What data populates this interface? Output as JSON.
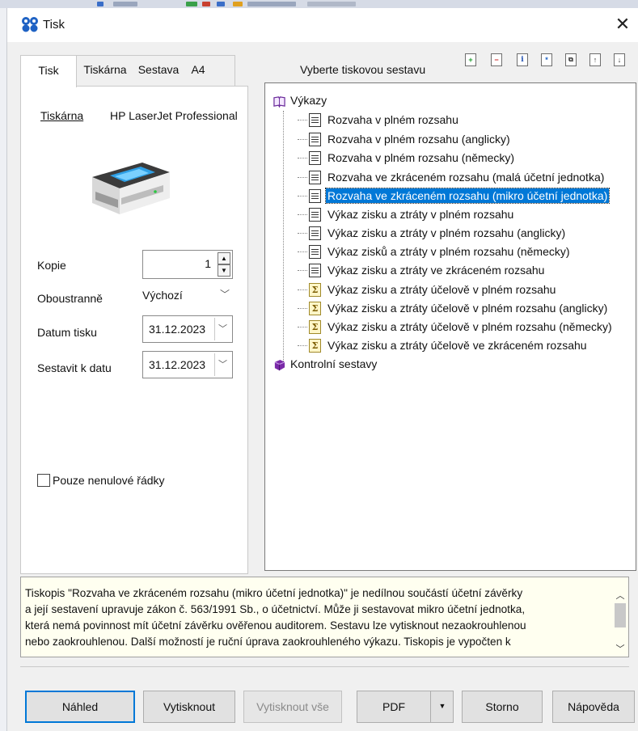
{
  "window": {
    "title": "Tisk",
    "close_glyph": "✕"
  },
  "tabs": [
    {
      "label": "Tisk",
      "active": true
    },
    {
      "label": "Tiskárna"
    },
    {
      "label": "Sestava"
    },
    {
      "label": "A4"
    }
  ],
  "printer": {
    "label": "Tiskárna",
    "name": "HP LaserJet Professional"
  },
  "fields": {
    "copies": {
      "label": "Kopie",
      "value": "1"
    },
    "duplex": {
      "label": "Oboustranně",
      "value": "Výchozí"
    },
    "print_date": {
      "label": "Datum tisku",
      "value": "31.12.2023"
    },
    "build_date": {
      "label": "Sestavit k datu",
      "value": "31.12.2023"
    }
  },
  "nonzero_checkbox": {
    "label": "Pouze nenulové řádky",
    "checked": false
  },
  "report_panel": {
    "title": "Vyberte tiskovou sestavu"
  },
  "toolbar_icons": [
    "add-icon",
    "remove-icon",
    "info-icon",
    "asterisk-icon",
    "copy-icon",
    "move-up-icon",
    "move-down-icon"
  ],
  "tree": {
    "root": "Výkazy",
    "items": [
      {
        "label": "Rozvaha v plném rozsahu",
        "icon": "document-icon"
      },
      {
        "label": "Rozvaha v plném rozsahu (anglicky)",
        "icon": "document-icon"
      },
      {
        "label": "Rozvaha v plném rozsahu (německy)",
        "icon": "document-icon"
      },
      {
        "label": "Rozvaha ve zkráceném rozsahu (malá účetní jednotka)",
        "icon": "document-icon"
      },
      {
        "label": "Rozvaha ve zkráceném rozsahu (mikro účetní jednotka)",
        "icon": "document-icon",
        "selected": true
      },
      {
        "label": "Výkaz zisku a ztráty v plném rozsahu",
        "icon": "document-icon"
      },
      {
        "label": "Výkaz zisku a ztráty v plném rozsahu (anglicky)",
        "icon": "document-icon"
      },
      {
        "label": "Výkaz zisků a ztráty v plném rozsahu (německy)",
        "icon": "document-icon"
      },
      {
        "label": "Výkaz zisku a ztráty ve zkráceném rozsahu",
        "icon": "document-icon"
      },
      {
        "label": "Výkaz zisku a ztráty účelově v plném rozsahu",
        "icon": "sum-icon"
      },
      {
        "label": "Výkaz zisku a ztráty účelově v plném rozsahu (anglicky)",
        "icon": "sum-icon"
      },
      {
        "label": "Výkaz zisku a ztráty účelově v plném rozsahu (německy)",
        "icon": "sum-icon"
      },
      {
        "label": "Výkaz zisku a ztráty účelově ve zkráceném rozsahu",
        "icon": "sum-icon"
      }
    ],
    "second_root": "Kontrolní sestavy"
  },
  "description": {
    "lines": [
      "Tiskopis \"Rozvaha ve zkráceném rozsahu (mikro účetní jednotka)\" je nedílnou součástí účetní závěrky",
      "a její sestavení upravuje zákon č. 563/1991 Sb., o účetnictví. Může ji sestavovat mikro účetní jednotka,",
      "která nemá povinnost mít účetní závěrku ověřenou auditorem. Sestavu lze vytisknout nezaokrouhlenou",
      "nebo zaokrouhlenou. Další možností je ruční úprava zaokrouhleného výkazu. Tiskopis je vypočten k"
    ]
  },
  "buttons": {
    "preview": "Náhled",
    "print": "Vytisknout",
    "print_all": "Vytisknout vše",
    "pdf": "PDF",
    "cancel": "Storno",
    "help": "Nápověda"
  },
  "colors": {
    "selection": "#0078d7",
    "description_bg": "#fffff0"
  }
}
